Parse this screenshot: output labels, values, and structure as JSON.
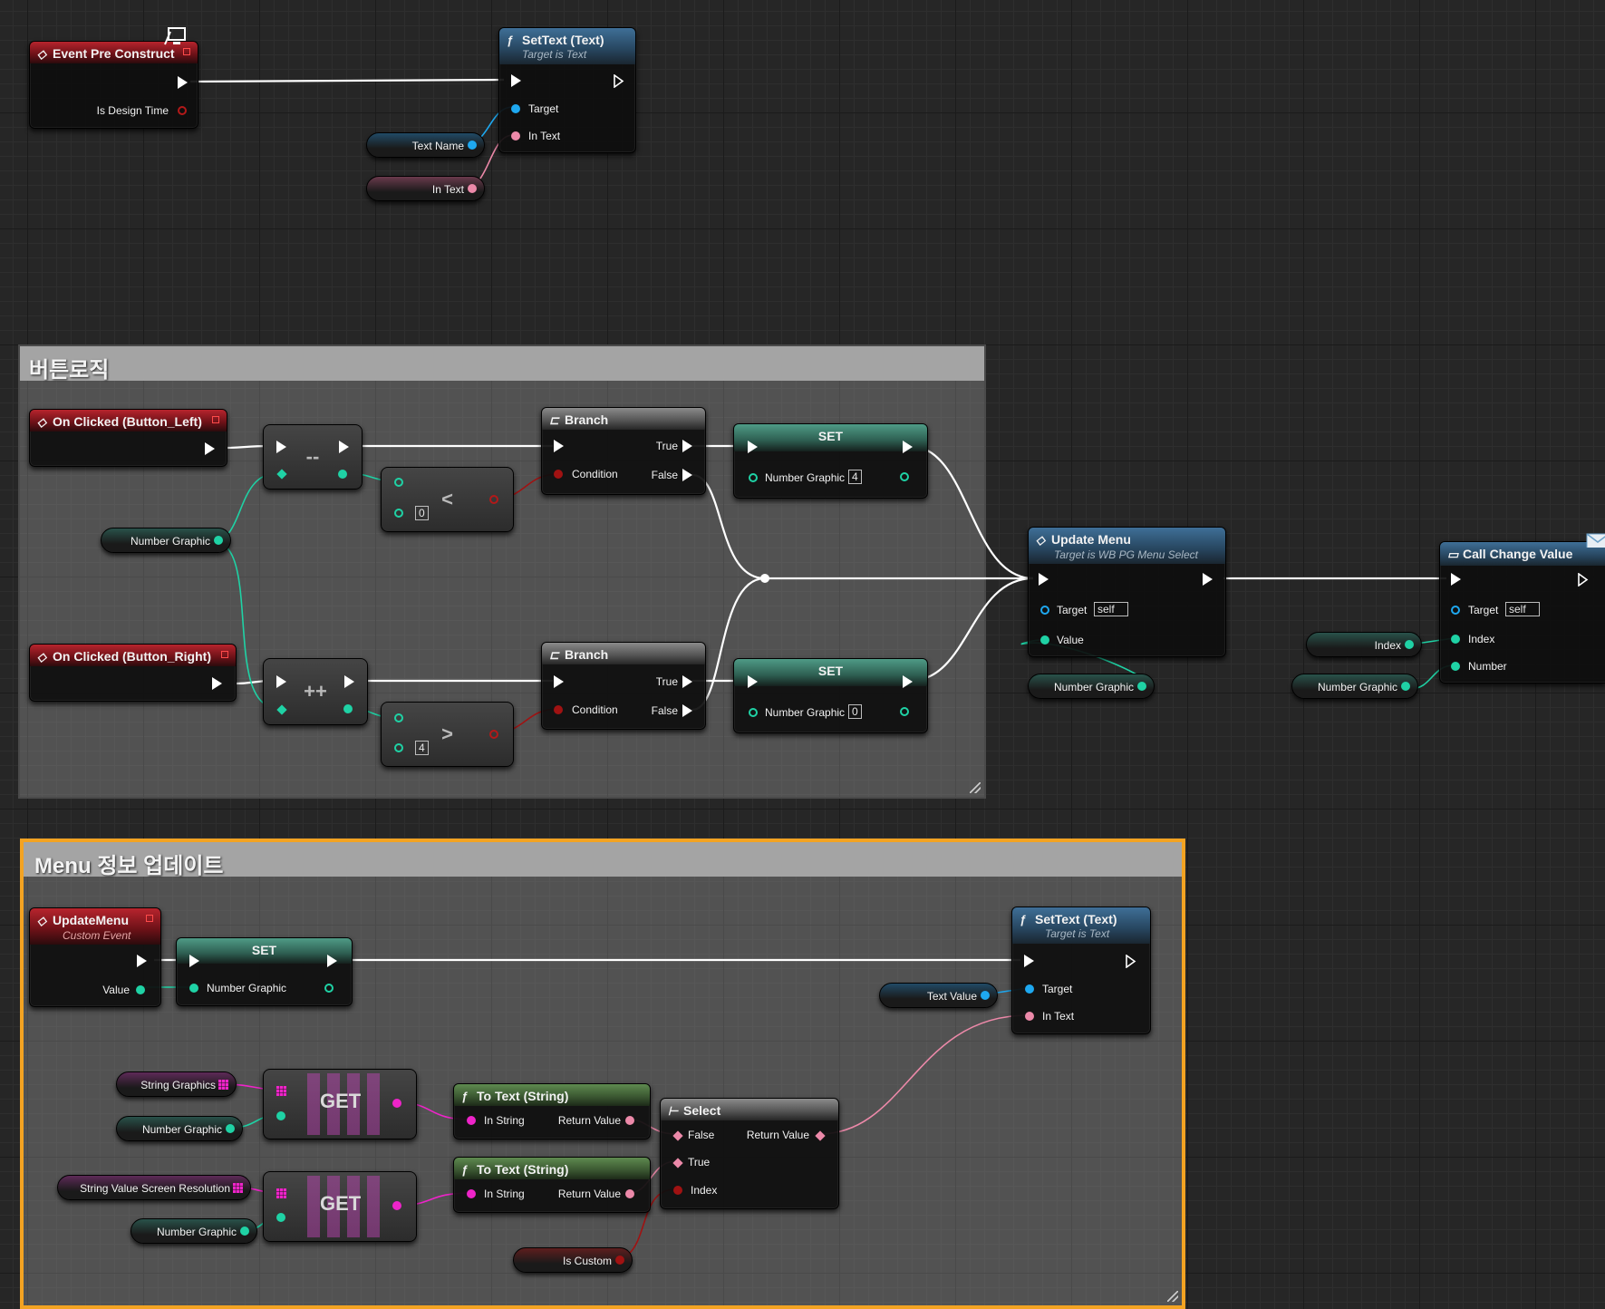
{
  "comments": {
    "button_logic": {
      "title": "버튼로직"
    },
    "menu_update": {
      "title": "Menu 정보 업데이트"
    }
  },
  "event_pre_construct": {
    "title": "Event Pre Construct",
    "is_design_time": "Is Design Time"
  },
  "settext_top": {
    "title": "SetText (Text)",
    "subtitle": "Target is Text",
    "target": "Target",
    "in_text": "In Text"
  },
  "var_text_name": "Text Name",
  "var_in_text": "In Text",
  "on_clicked_left": {
    "title": "On Clicked (Button_Left)"
  },
  "on_clicked_right": {
    "title": "On Clicked (Button_Right)"
  },
  "decrement": {
    "symbol": "--"
  },
  "increment": {
    "symbol": "++"
  },
  "less": {
    "symbol": "<",
    "value": "0"
  },
  "greater": {
    "symbol": ">",
    "value": "4"
  },
  "var_number_graphic": "Number Graphic",
  "branch_top": {
    "title": "Branch",
    "true": "True",
    "false": "False",
    "condition": "Condition"
  },
  "branch_bottom": {
    "title": "Branch",
    "true": "True",
    "false": "False",
    "condition": "Condition"
  },
  "set_top": {
    "title": "SET",
    "var": "Number Graphic",
    "value": "4"
  },
  "set_bottom": {
    "title": "SET",
    "var": "Number Graphic",
    "value": "0"
  },
  "update_menu_call": {
    "title": "Update Menu",
    "subtitle": "Target is WB PG Menu Select",
    "target": "Target",
    "target_value": "self",
    "value": "Value"
  },
  "call_change_value": {
    "title": "Call Change Value",
    "target": "Target",
    "target_value": "self",
    "index": "Index",
    "number": "Number"
  },
  "var_index": "Index",
  "update_menu_event": {
    "title": "UpdateMenu",
    "subtitle": "Custom Event",
    "value": "Value"
  },
  "set_menu": {
    "title": "SET",
    "var": "Number Graphic"
  },
  "settext_bottom": {
    "title": "SetText (Text)",
    "subtitle": "Target is Text",
    "target": "Target",
    "in_text": "In Text"
  },
  "var_text_value": "Text Value",
  "var_string_graphics": "String Graphics",
  "var_string_value_screen_resolution": "String Value Screen Resolution",
  "var_is_custom": "Is Custom",
  "get": {
    "label": "GET"
  },
  "to_text_1": {
    "title": "To Text (String)",
    "in_string": "In String",
    "return_value": "Return Value"
  },
  "to_text_2": {
    "title": "To Text (String)",
    "in_string": "In String",
    "return_value": "Return Value"
  },
  "select": {
    "title": "Select",
    "false": "False",
    "true": "True",
    "index": "Index",
    "return_value": "Return Value"
  },
  "colors": {
    "exec": "#ffffff",
    "bool": "#a01212",
    "int": "#1fd2a5",
    "text": "#ec89a9",
    "string": "#ee24c9",
    "object": "#1ea8f0",
    "selection": "#f3a322"
  }
}
